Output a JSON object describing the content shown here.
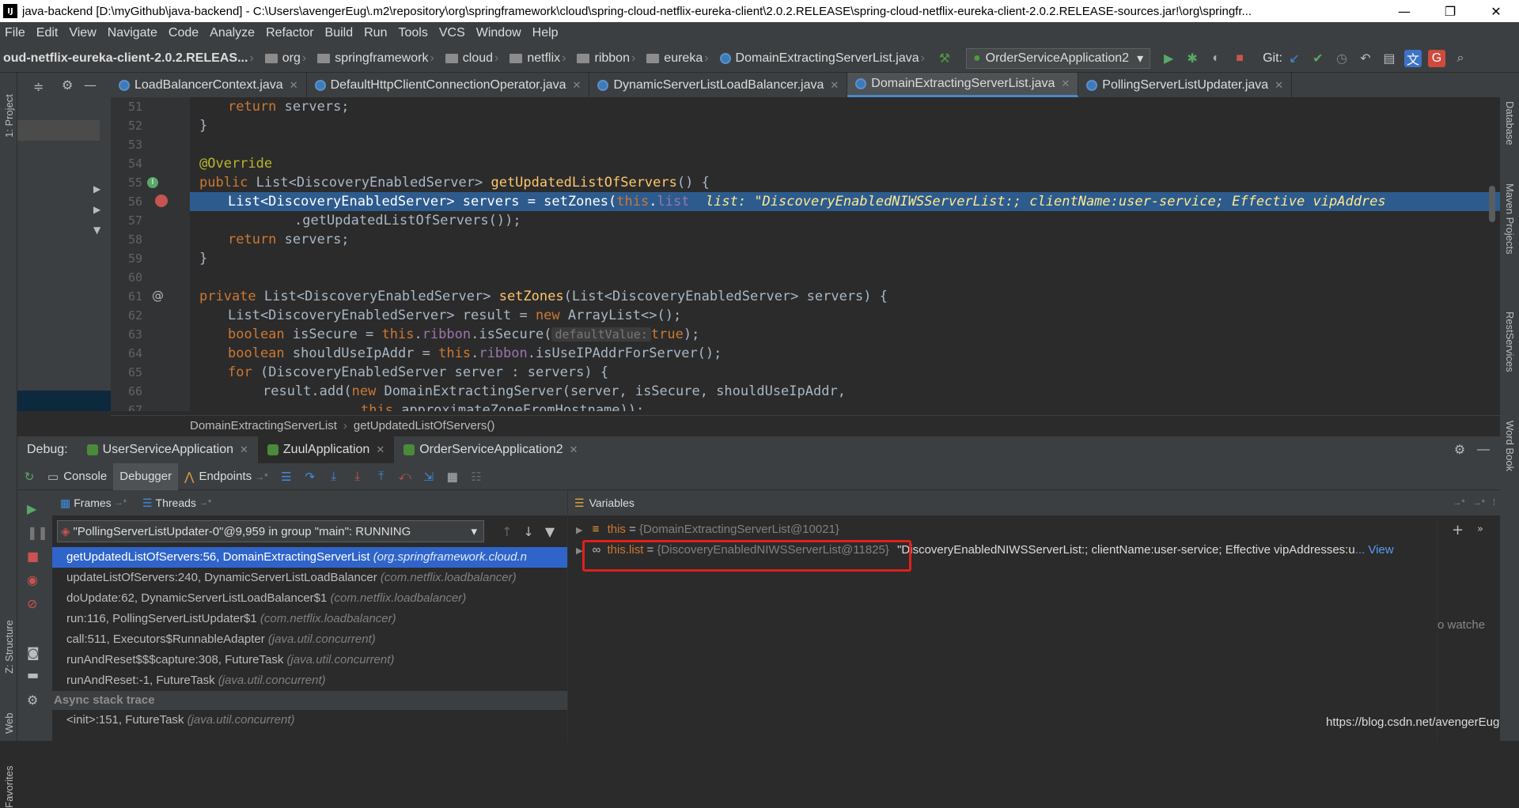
{
  "window": {
    "title": "java-backend [D:\\myGithub\\java-backend] - C:\\Users\\avengerEug\\.m2\\repository\\org\\springframework\\cloud\\spring-cloud-netflix-eureka-client\\2.0.2.RELEASE\\spring-cloud-netflix-eureka-client-2.0.2.RELEASE-sources.jar!\\org\\springfr...",
    "minimize": "—",
    "maximize": "❐",
    "close": "✕"
  },
  "menu": [
    "File",
    "Edit",
    "View",
    "Navigate",
    "Code",
    "Analyze",
    "Refactor",
    "Build",
    "Run",
    "Tools",
    "VCS",
    "Window",
    "Help"
  ],
  "nav": {
    "crumbs": [
      "oud-netflix-eureka-client-2.0.2.RELEAS...",
      "org",
      "springframework",
      "cloud",
      "netflix",
      "ribbon",
      "eureka",
      "DomainExtractingServerList.java"
    ],
    "run_config": "OrderServiceApplication2",
    "git_label": "Git:"
  },
  "left_strip": {
    "project": "1: Project",
    "structure": "Z: Structure",
    "web": "Web",
    "favorites": "Favorites"
  },
  "right_strip": {
    "database": "Database",
    "maven": "Maven Projects",
    "rest": "RestServices",
    "wordbook": "Word Book"
  },
  "tabs": [
    {
      "label": "LoadBalancerContext.java"
    },
    {
      "label": "DefaultHttpClientConnectionOperator.java"
    },
    {
      "label": "DynamicServerListLoadBalancer.java"
    },
    {
      "label": "DomainExtractingServerList.java"
    },
    {
      "label": "PollingServerListUpdater.java"
    }
  ],
  "editor": {
    "line_numbers": [
      "51",
      "52",
      "53",
      "54",
      "55",
      "56",
      "57",
      "58",
      "59",
      "60",
      "61",
      "62",
      "63",
      "64",
      "65",
      "66",
      "67"
    ],
    "l51": {
      "a": "return",
      "b": " servers;"
    },
    "l52": "}",
    "l54": "@Override",
    "l55": {
      "a": "public",
      "b": " List<DiscoveryEnabledServer> ",
      "c": "getUpdatedListOfServers",
      "d": "() {"
    },
    "l56": {
      "a": "List<DiscoveryEnabledServer> servers = setZones(",
      "b": "this",
      "c": ".",
      "d": "list",
      "e": "  list: \"DiscoveryEnabledNIWSServerList:; clientName:user-service; Effective vipAddres"
    },
    "l57": ".getUpdatedListOfServers());",
    "l58": {
      "a": "return",
      "b": " servers;"
    },
    "l59": "}",
    "l61": {
      "a": "private",
      "b": " List<DiscoveryEnabledServer> ",
      "c": "setZones",
      "d": "(List<DiscoveryEnabledServer> servers) {"
    },
    "l62": {
      "a": "List<DiscoveryEnabledServer> result = ",
      "b": "new",
      "c": " ArrayList<>();"
    },
    "l63": {
      "a": "boolean",
      "b": " isSecure = ",
      "c": "this",
      "d": ".",
      "e": "ribbon",
      "f": ".isSecure(",
      "g": "defaultValue:",
      "h": "true",
      "i": ");"
    },
    "l64": {
      "a": "boolean",
      "b": " shouldUseIpAddr = ",
      "c": "this",
      "d": ".",
      "e": "ribbon",
      "f": ".isUseIPAddrForServer();"
    },
    "l65": {
      "a": "for",
      "b": " (DiscoveryEnabledServer server : servers) {"
    },
    "l66": {
      "a": "result.add(",
      "b": "new",
      "c": " DomainExtractingServer(server, isSecure, shouldUseIpAddr,"
    },
    "l67": {
      "a": "this",
      "b": ".approximateZoneFromHostname));"
    }
  },
  "breadcrumb": {
    "cls": "DomainExtractingServerList",
    "method": "getUpdatedListOfServers()"
  },
  "debug": {
    "label": "Debug:",
    "sessions": [
      {
        "label": "UserServiceApplication"
      },
      {
        "label": "ZuulApplication"
      },
      {
        "label": "OrderServiceApplication2"
      }
    ],
    "console": "Console",
    "debugger": "Debugger",
    "endpoints": "Endpoints"
  },
  "frames": {
    "frames_label": "Frames",
    "threads_label": "Threads",
    "thread": "\"PollingServerListUpdater-0\"@9,959 in group \"main\": RUNNING",
    "items": [
      {
        "m": "getUpdatedListOfServers:56, DomainExtractingServerList",
        "p": "(org.springframework.cloud.n"
      },
      {
        "m": "updateListOfServers:240, DynamicServerListLoadBalancer",
        "p": "(com.netflix.loadbalancer)"
      },
      {
        "m": "doUpdate:62, DynamicServerListLoadBalancer$1",
        "p": "(com.netflix.loadbalancer)"
      },
      {
        "m": "run:116, PollingServerListUpdater$1",
        "p": "(com.netflix.loadbalancer)"
      },
      {
        "m": "call:511, Executors$RunnableAdapter",
        "p": "(java.util.concurrent)"
      },
      {
        "m": "runAndReset$$$capture:308, FutureTask",
        "p": "(java.util.concurrent)"
      },
      {
        "m": "runAndReset:-1, FutureTask",
        "p": "(java.util.concurrent)"
      }
    ],
    "async": "Async stack trace",
    "async_item": {
      "m": "<init>:151, FutureTask",
      "p": "(java.util.concurrent)"
    }
  },
  "variables": {
    "label": "Variables",
    "this_name": "this",
    "this_val": "{DomainExtractingServerList@10021}",
    "list_name": "this.list",
    "list_val": "{DiscoveryEnabledNIWSServerList@11825}",
    "list_str": "\"DiscoveryEnabledNIWSServerList:; clientName:user-service; Effective vipAddresses:u",
    "view": "... View",
    "watches": "o watche"
  },
  "watermark": "https://blog.csdn.net/avengerEug",
  "colors": {
    "accent": "#2f65ca",
    "highlight_line": "#2d5b8e",
    "annotation_box": "#e0201a"
  }
}
